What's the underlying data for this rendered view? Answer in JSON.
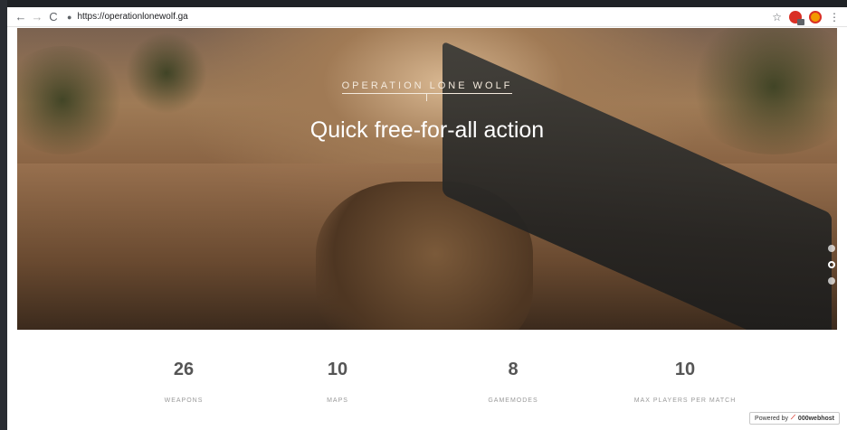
{
  "browser": {
    "url": "https://operationlonewolf.ga",
    "back_icon": "←",
    "forward_icon": "→",
    "reload_icon": "C",
    "lock_icon": "●",
    "star_icon": "☆",
    "menu_icon": "⋮"
  },
  "hero": {
    "kicker": "OPERATION LONE WOLF",
    "title": "Quick free-for-all action",
    "slide_index": 2,
    "slides_total": 3
  },
  "stats": [
    {
      "number": "26",
      "label": "WEAPONS"
    },
    {
      "number": "10",
      "label": "MAPS"
    },
    {
      "number": "8",
      "label": "GAMEMODES"
    },
    {
      "number": "10",
      "label": "MAX PLAYERS PER MATCH"
    }
  ],
  "footer": {
    "powered_by": "Powered by",
    "brand": "000webhost"
  }
}
